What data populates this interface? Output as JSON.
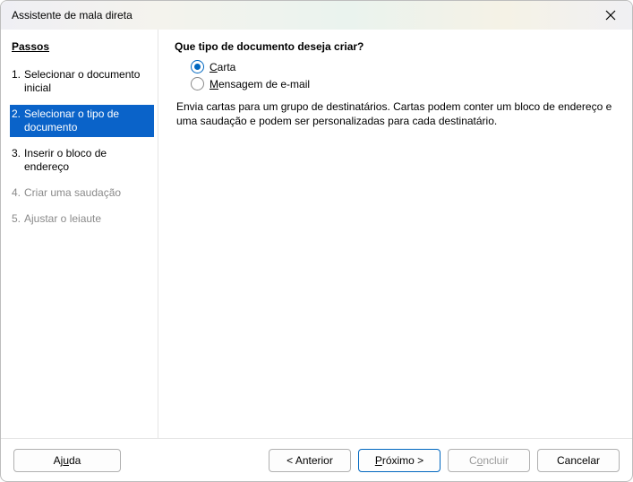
{
  "window": {
    "title": "Assistente de mala direta"
  },
  "sidebar": {
    "heading": "Passos",
    "steps": [
      {
        "num": "1.",
        "label": "Selecionar o documento inicial",
        "selected": false,
        "disabled": false
      },
      {
        "num": "2.",
        "label": "Selecionar o tipo de documento",
        "selected": true,
        "disabled": false
      },
      {
        "num": "3.",
        "label": "Inserir o bloco de endereço",
        "selected": false,
        "disabled": false
      },
      {
        "num": "4.",
        "label": "Criar uma saudação",
        "selected": false,
        "disabled": true
      },
      {
        "num": "5.",
        "label": "Ajustar o leiaute",
        "selected": false,
        "disabled": true
      }
    ]
  },
  "content": {
    "heading": "Que tipo de documento deseja criar?",
    "options": [
      {
        "accel": "C",
        "rest": "arta",
        "checked": true
      },
      {
        "accel": "M",
        "rest": "ensagem de e-mail",
        "checked": false
      }
    ],
    "description": "Envia cartas para um grupo de destinatários. Cartas podem conter um bloco de endereço e uma saudação e podem ser personalizadas para cada destinatário."
  },
  "footer": {
    "help": {
      "pre": "Aj",
      "accel": "u",
      "post": "da"
    },
    "prev": "< Anterior",
    "next": {
      "accel": "P",
      "rest": "róximo >"
    },
    "finish": {
      "pre": "C",
      "accel": "o",
      "post": "ncluir"
    },
    "cancel": "Cancelar"
  }
}
